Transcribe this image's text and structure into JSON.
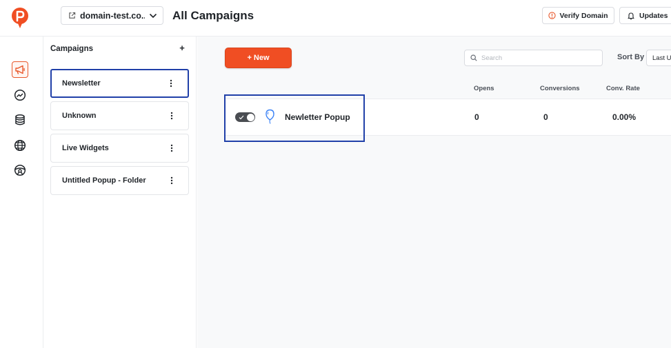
{
  "header": {
    "domain": "domain-test.co...",
    "page_title": "All Campaigns",
    "verify_label": "Verify Domain",
    "updates_label": "Updates"
  },
  "rail": {
    "icons": [
      "megaphone-icon",
      "trending-icon",
      "database-icon",
      "globe-icon",
      "steering-wheel-icon"
    ]
  },
  "sidebar": {
    "title": "Campaigns",
    "add_label": "+",
    "folders": [
      {
        "label": "Newsletter"
      },
      {
        "label": "Unknown"
      },
      {
        "label": "Live Widgets"
      },
      {
        "label": "Untitled Popup - Folder"
      }
    ]
  },
  "main": {
    "new_label": "+ New",
    "search_placeholder": "Search",
    "sort_label": "Sort By",
    "sort_value": "Last Updated",
    "columns": {
      "opens": "Opens",
      "conversions": "Conversions",
      "conv_rate": "Conv. Rate"
    },
    "campaign": {
      "name": "Newletter Popup",
      "opens": "0",
      "conversions": "0",
      "conv_rate": "0.00%",
      "enabled": true
    }
  },
  "colors": {
    "accent": "#f04e23",
    "highlight": "#1f3fa8",
    "balloon": "#3b82f6"
  }
}
